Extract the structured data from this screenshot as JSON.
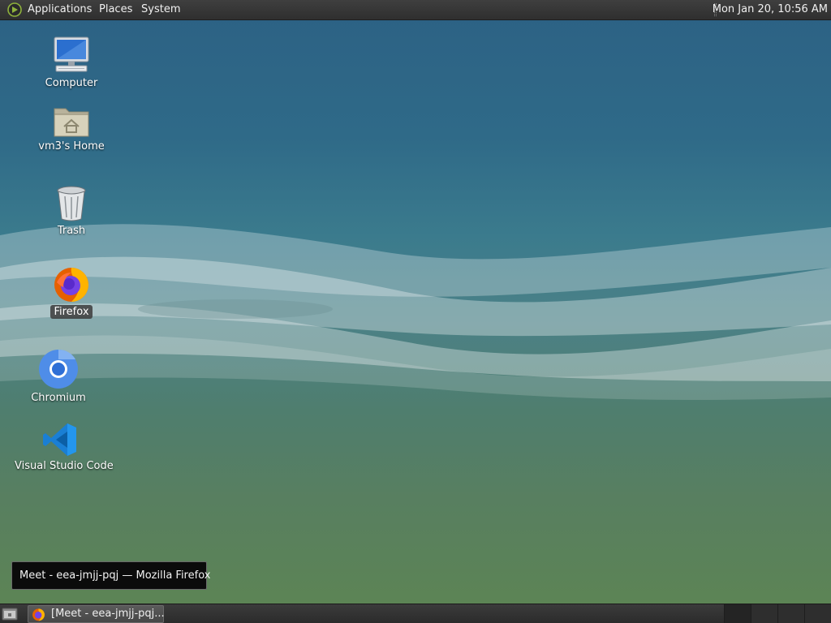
{
  "top_panel": {
    "menus": [
      "Applications",
      "Places",
      "System"
    ],
    "clock": "Mon Jan 20, 10:56 AM"
  },
  "desktop_icons": [
    {
      "label": "Computer",
      "icon": "computer-icon"
    },
    {
      "label": "vm3's Home",
      "icon": "home-folder-icon"
    },
    {
      "label": "Trash",
      "icon": "trash-icon"
    },
    {
      "label": "Firefox",
      "icon": "firefox-icon",
      "selected": true
    },
    {
      "label": "Chromium",
      "icon": "chromium-icon"
    },
    {
      "label": "Visual Studio Code",
      "icon": "vscode-icon"
    }
  ],
  "tooltip": {
    "text": "Meet - eea-jmjj-pqj — Mozilla Firefox"
  },
  "taskbar": {
    "tasks": [
      {
        "label": "[Meet - eea-jmjj-pqj...",
        "icon": "firefox-icon"
      }
    ],
    "workspace_count": 4
  },
  "colors": {
    "panel": "#333333",
    "wallpaper_top": "#2c6184",
    "wallpaper_bottom": "#5d8553"
  }
}
